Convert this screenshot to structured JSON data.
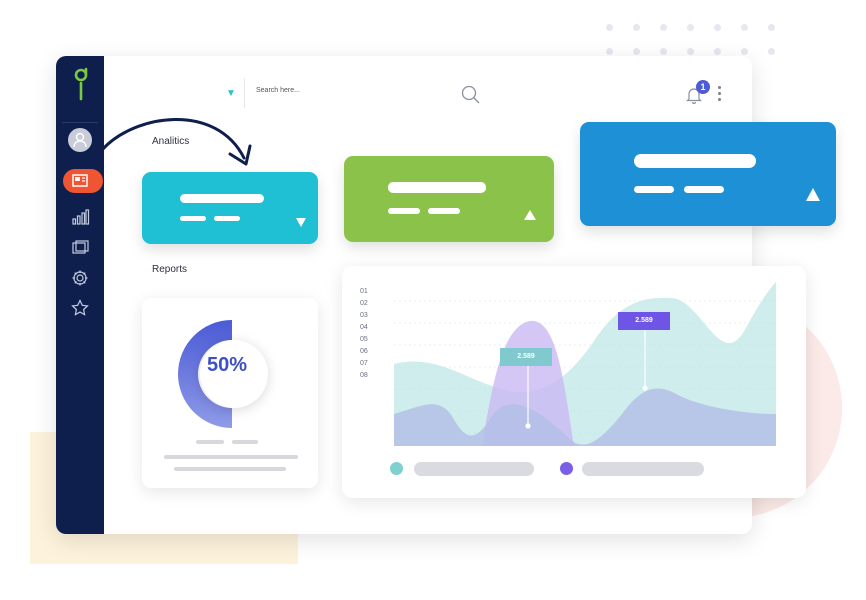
{
  "header": {
    "search_placeholder": "Search here...",
    "notifications_count": "1"
  },
  "sections": {
    "analytics_title": "Analitics",
    "reports_title": "Reports"
  },
  "stat_cards": [
    {
      "color": "#1fc0d4",
      "trend": "down"
    },
    {
      "color": "#8bc34a",
      "trend": "up"
    },
    {
      "color": "#1e90d6",
      "trend": "up"
    }
  ],
  "donut": {
    "percent_label": "50%",
    "value": 0.5,
    "colors": {
      "fill": "#4b5bd6",
      "track": "#ffffff"
    }
  },
  "chart_data": {
    "type": "area",
    "y_ticks": [
      "01",
      "02",
      "03",
      "04",
      "05",
      "06",
      "07",
      "08"
    ],
    "annotations": [
      {
        "label": "2.589",
        "color": "#7fc9cf"
      },
      {
        "label": "2.589",
        "color": "#6f55e6"
      }
    ],
    "series_colors": [
      "#bfe7e6",
      "#c9b8f2",
      "#b4bfe8"
    ],
    "legend": [
      {
        "color": "#7fd0cf"
      },
      {
        "color": "#7a5ee6"
      }
    ]
  },
  "colors": {
    "sidebar": "#0f1f4d",
    "active_nav": "#ef5533",
    "logo": "#7ac943"
  }
}
